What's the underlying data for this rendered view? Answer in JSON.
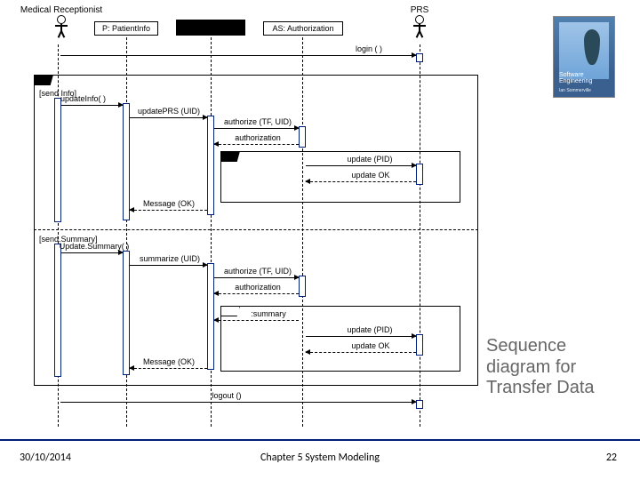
{
  "actors": {
    "receptionist": "Medical Receptionist",
    "prs": "PRS"
  },
  "lifelines": {
    "patient": "P: PatientInfo",
    "blackbox": "",
    "auth": "AS: Authorization"
  },
  "fragments": {
    "send_info": "[send Info]",
    "send_summary": "[send.Summary]"
  },
  "messages": {
    "login": "login ( )",
    "updateInfo": "updateInfo( )",
    "updatePRS1": "updatePRS (UID)",
    "authorize1": "authorize (TF, UID)",
    "authorization1": "authorization",
    "updatePID1": "update (PID)",
    "updateOK1": "update OK",
    "messageOK1": "Message (OK)",
    "updateSummary": "Update.Summary( )",
    "summarize": "summarize (UID)",
    "authorize2": "authorize (TF, UID)",
    "authorization2": "authorization",
    "summary": ":summary",
    "updatePID2": "update (PID)",
    "updateOK2": "update OK",
    "messageOK2": "Message (OK)",
    "logout": "logout ()"
  },
  "caption": "Sequence diagram for Transfer Data",
  "footer": {
    "date": "30/10/2014",
    "chapter": "Chapter 5 System Modeling",
    "page": "22"
  },
  "book": {
    "title": "Software Engineering",
    "author": "Ian Sommerville"
  }
}
